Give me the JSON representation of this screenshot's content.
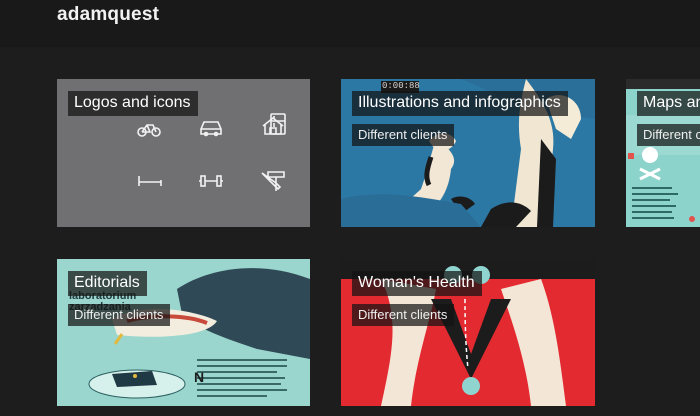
{
  "site": {
    "title": "adamquest"
  },
  "tiles": [
    {
      "title": "Logos and icons",
      "subtitle": ""
    },
    {
      "title": "Illustrations and infographics",
      "subtitle": "Different clients"
    },
    {
      "title": "Maps and infographics",
      "subtitle": "Different clients"
    },
    {
      "title": "Editorials",
      "subtitle": "Different clients"
    },
    {
      "title": "Woman's Health",
      "subtitle": "Different clients"
    }
  ],
  "art_text": {
    "timer": "0:00:88",
    "editorial_headline": "laboratorium zarzadzania",
    "editorial_letter": "N"
  },
  "icons": [
    "bicycle-icon",
    "car-icon",
    "house-icon",
    "fridge-icon",
    "bed-icon",
    "dumbbell-icon",
    "knife-icon",
    "hammer-icon"
  ],
  "colors": {
    "background": "#1d1d1d",
    "header": "#191919",
    "grey_tile": "#707073",
    "accent_red": "#e0262e",
    "teal": "#8fd4ce"
  }
}
